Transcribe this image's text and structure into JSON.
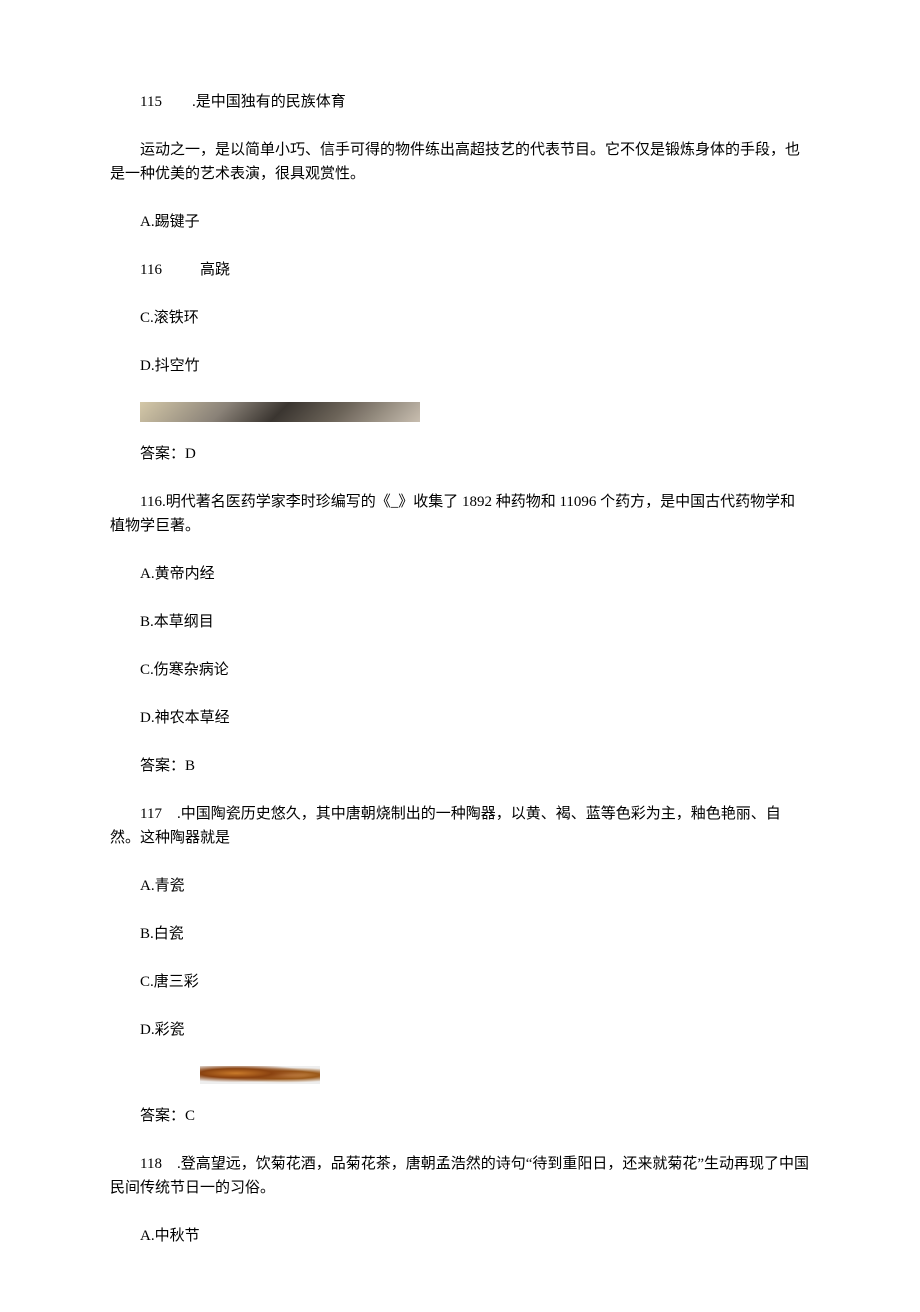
{
  "q115": {
    "num": "115",
    "head": ".是中国独有的民族体育",
    "body": "运动之一，是以简单小巧、信手可得的物件练出高超技艺的代表节目。它不仅是锻炼身体的手段，也是一种优美的艺术表演，很具观赏性。",
    "optA": "A.踢键子",
    "optB_num": "116",
    "optB_text": "高跷",
    "optC": "C.滚铁环",
    "optD": "D.抖空竹",
    "answer": "答案：D"
  },
  "q116": {
    "text": "116.明代著名医药学家李时珍编写的《_》收集了 1892 种药物和 11096 个药方，是中国古代药物学和植物学巨著。",
    "optA": "A.黄帝内经",
    "optB": "B.本草纲目",
    "optC": "C.伤寒杂病论",
    "optD": "D.神农本草经",
    "answer": "答案：B"
  },
  "q117": {
    "text": "117　.中国陶瓷历史悠久，其中唐朝烧制出的一种陶器，以黄、褐、蓝等色彩为主，釉色艳丽、自然。这种陶器就是",
    "optA": "A.青瓷",
    "optB": "B.白瓷",
    "optC": "C.唐三彩",
    "optD": "D.彩瓷",
    "answer": "答案：C"
  },
  "q118": {
    "text": "118　.登高望远，饮菊花酒，品菊花茶，唐朝孟浩然的诗句“待到重阳日，还来就菊花”生动再现了中国民间传统节日一的习俗。",
    "optA": "A.中秋节"
  }
}
